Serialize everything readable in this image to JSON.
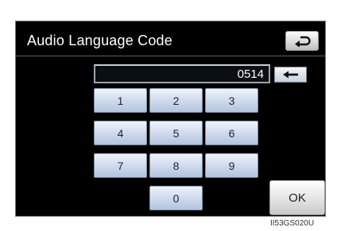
{
  "screen": {
    "title": "Audio Language Code"
  },
  "display": {
    "value": "0514"
  },
  "keypad": {
    "keys": [
      "1",
      "2",
      "3",
      "4",
      "5",
      "6",
      "7",
      "8",
      "9",
      "0"
    ]
  },
  "buttons": {
    "ok_label": "OK"
  },
  "icons": {
    "back": "return-arrow-icon",
    "backspace": "left-arrow-icon"
  },
  "figure": {
    "code": "II53GS020U"
  }
}
